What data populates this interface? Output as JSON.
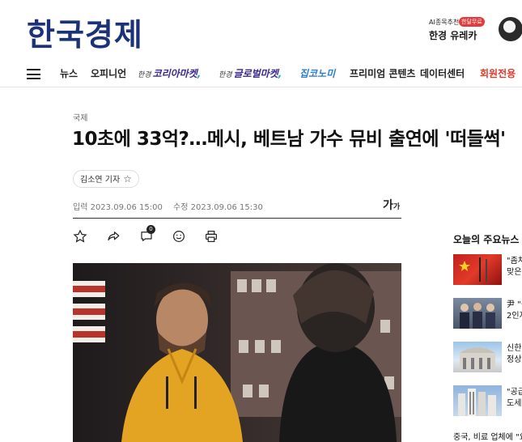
{
  "header": {
    "logo": "한국경제",
    "promo_ai": "AI종목추천",
    "promo_badge": "한달무료",
    "promo_brand": "한경 유레카"
  },
  "nav": {
    "items": [
      {
        "label": "뉴스"
      },
      {
        "label": "오피니언"
      },
      {
        "pre": "한경",
        "label": "코리아마켓"
      },
      {
        "pre": "한경",
        "label": "글로벌마켓"
      },
      {
        "label": "집코노미"
      },
      {
        "label": "프리미엄 콘텐츠"
      },
      {
        "label": "데이터센터"
      },
      {
        "label": "회원전용"
      }
    ]
  },
  "article": {
    "category": "국제",
    "headline": "10초에 33억?…메시, 베트남 가수 뮤비 출연에 '떠들썩'",
    "reporter": "김소연 기자",
    "published": "입력 2023.09.06 15:00",
    "modified": "수정 2023.09.06 15:30",
    "font_size_label": "가",
    "font_size_small": "가",
    "comment_count": "0"
  },
  "sidebar": {
    "title": "오늘의 주요뉴스",
    "items": [
      {
        "line1": "\"좀처",
        "line2": "맞은"
      },
      {
        "line1": "尹 \"중",
        "line2": "2인지"
      },
      {
        "line1": "신한",
        "line2": "정상"
      },
      {
        "line1": "\"공급",
        "line2": "도세"
      }
    ],
    "last": "중국, 비료 업체에 \"요소"
  },
  "colors": {
    "logo": "#1c3278",
    "accent_red": "#e0392b",
    "brand_purple": "#3a2a8f"
  }
}
